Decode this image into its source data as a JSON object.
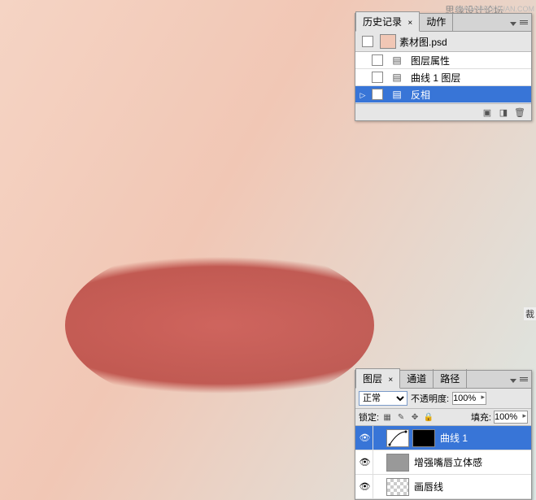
{
  "watermark": {
    "text": "思缘设计论坛",
    "url": "WWW.MISSYUAN.COM"
  },
  "history_panel": {
    "tabs": [
      {
        "label": "历史记录",
        "active": true
      },
      {
        "label": "动作",
        "active": false
      }
    ],
    "source_doc": "素材图.psd",
    "items": [
      {
        "label": "图层属性",
        "selected": false,
        "arrow": false
      },
      {
        "label": "曲线 1 图层",
        "selected": false,
        "arrow": false
      },
      {
        "label": "反相",
        "selected": true,
        "arrow": true
      }
    ]
  },
  "partial_label": "裁",
  "layers_panel": {
    "tabs": [
      {
        "label": "图层",
        "active": true
      },
      {
        "label": "通道",
        "active": false
      },
      {
        "label": "路径",
        "active": false
      }
    ],
    "blend_mode": "正常",
    "opacity_label": "不透明度:",
    "opacity_value": "100%",
    "lock_label": "锁定:",
    "fill_label": "填充:",
    "fill_value": "100%",
    "layers": [
      {
        "name": "曲线 1",
        "visible": true,
        "selected": true,
        "thumb_type": "curves",
        "mask": "black"
      },
      {
        "name": "增强嘴唇立体感",
        "visible": true,
        "selected": false,
        "thumb_type": "grey",
        "mask": null
      },
      {
        "name": "画唇线",
        "visible": true,
        "selected": false,
        "thumb_type": "checker",
        "mask": null
      }
    ]
  }
}
